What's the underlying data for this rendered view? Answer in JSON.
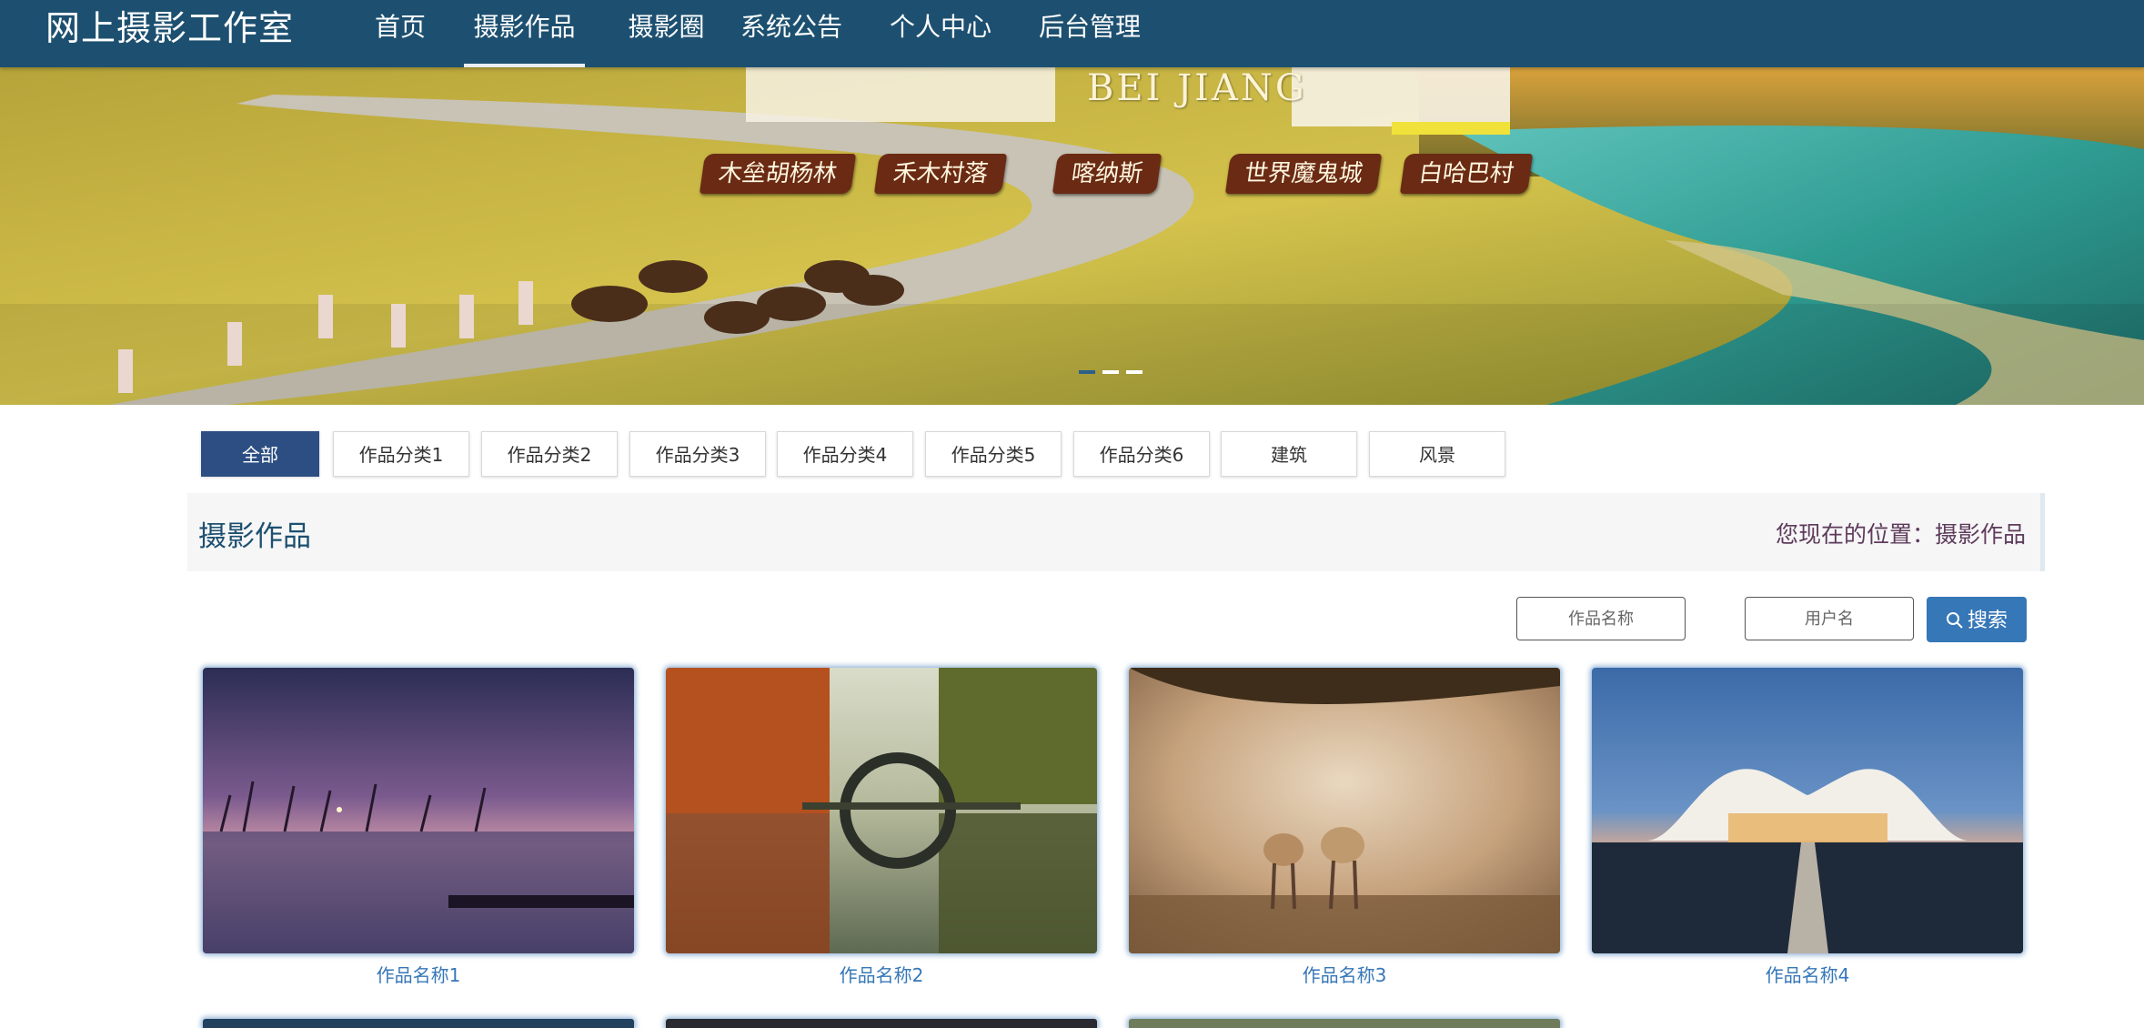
{
  "nav": {
    "brand": "网上摄影工作室",
    "items": [
      "首页",
      "摄影作品",
      "摄影圈",
      "系统公告",
      "个人中心",
      "后台管理"
    ],
    "active_index": 1
  },
  "banner": {
    "title_latin": "BEI JIANG",
    "tags": [
      "木垒胡杨林",
      "禾木村落",
      "喀纳斯",
      "世界魔鬼城",
      "白哈巴村"
    ],
    "slides": 3,
    "active_slide": 0
  },
  "categories": {
    "items": [
      "全部",
      "作品分类1",
      "作品分类2",
      "作品分类3",
      "作品分类4",
      "作品分类5",
      "作品分类6",
      "建筑",
      "风景"
    ],
    "active_index": 0
  },
  "section": {
    "title": "摄影作品",
    "breadcrumb": "您现在的位置：摄影作品"
  },
  "search": {
    "name_placeholder": "作品名称",
    "user_placeholder": "用户名",
    "button_label": "搜索"
  },
  "works": [
    {
      "name": "作品名称1"
    },
    {
      "name": "作品名称2"
    },
    {
      "name": "作品名称3"
    },
    {
      "name": "作品名称4"
    }
  ],
  "colors": {
    "nav_bg": "#1d5070",
    "active_tab": "#2c4e82",
    "accent": "#3677b7",
    "section_title": "#1d5070",
    "breadcrumb": "#5e3b5c"
  }
}
